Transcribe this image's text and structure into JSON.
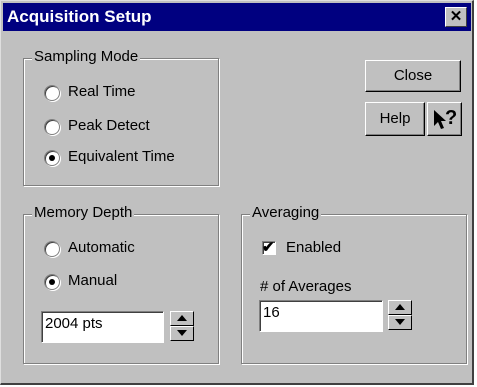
{
  "window": {
    "title": "Acquisition Setup",
    "close_glyph": "✕"
  },
  "sampling_mode": {
    "legend": "Sampling Mode",
    "options": [
      {
        "label": "Real Time",
        "selected": false
      },
      {
        "label": "Peak Detect",
        "selected": false
      },
      {
        "label": "Equivalent Time",
        "selected": true
      }
    ]
  },
  "buttons": {
    "close_label": "Close",
    "help_label": "Help",
    "context_help_glyph": "?"
  },
  "memory_depth": {
    "legend": "Memory Depth",
    "options": [
      {
        "label": "Automatic",
        "selected": false
      },
      {
        "label": "Manual",
        "selected": true
      }
    ],
    "value": "2004 pts"
  },
  "averaging": {
    "legend": "Averaging",
    "enabled_label": "Enabled",
    "enabled": true,
    "count_label": "# of Averages",
    "count_value": "16"
  },
  "colors": {
    "titlebar": "#000080",
    "face": "#c0c0c0"
  },
  "icons": {
    "context_help": "pointer-question-icon",
    "spin_up": "triangle-up-icon",
    "spin_down": "triangle-down-icon"
  }
}
